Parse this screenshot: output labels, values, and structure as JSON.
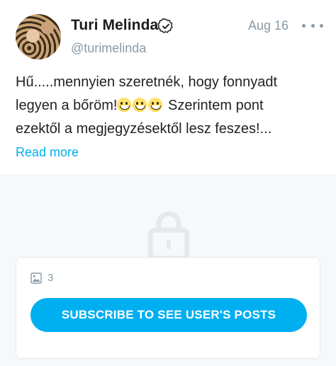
{
  "author": {
    "name": "Turi Melinda",
    "username": "@turimelinda",
    "verified_icon": "verified-check-icon"
  },
  "post": {
    "date": "Aug 16",
    "lines": [
      "Hű.....mennyien szeretnék, hogy fonnyadt",
      "legyen a bőröm!",
      "Szerintem pont",
      "ezektől a megjegyzésektől lesz feszes!..."
    ],
    "emoji_count": 3,
    "read_more": "Read more"
  },
  "locked": {
    "media_count": "3",
    "subscribe_label": "SUBSCRIBE TO SEE USER'S POSTS"
  },
  "colors": {
    "accent": "#00aff0",
    "muted": "#8a9aa6",
    "locked_bg": "#f7f8fa"
  }
}
